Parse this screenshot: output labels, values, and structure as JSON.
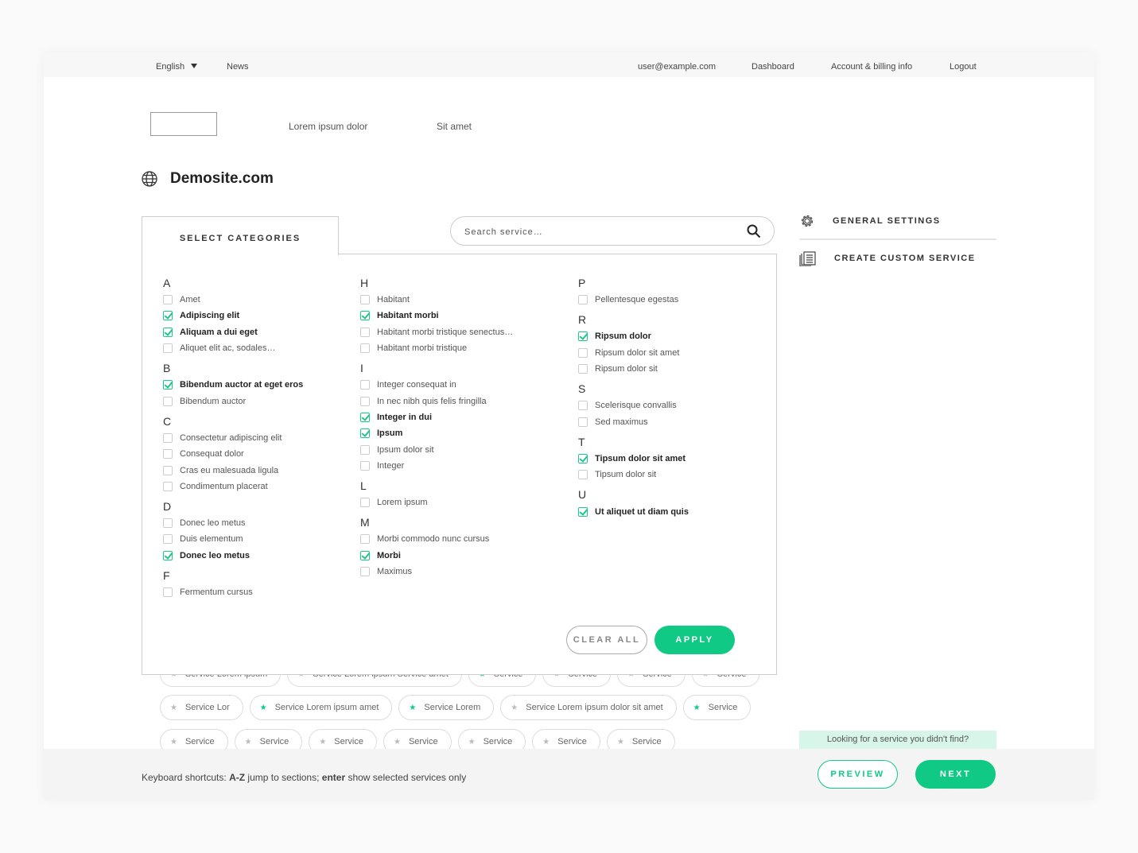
{
  "topbar": {
    "language": "English",
    "news": "News",
    "email": "user@example.com",
    "dashboard": "Dashboard",
    "account": "Account & billing info",
    "logout": "Logout"
  },
  "nav": {
    "item1": "Lorem ipsum dolor",
    "item2": "Sit amet"
  },
  "site": {
    "title": "Demosite.com"
  },
  "categories_tab": "SELECT CATEGORIES",
  "search": {
    "placeholder": "Search service…"
  },
  "columns": [
    [
      {
        "letter": "A",
        "items": [
          [
            "Amet",
            false
          ],
          [
            "Adipiscing elit",
            true
          ],
          [
            "Aliquam a dui eget",
            true
          ],
          [
            "Aliquet elit ac, sodales…",
            false
          ]
        ]
      },
      {
        "letter": "B",
        "items": [
          [
            "Bibendum auctor at eget eros",
            true
          ],
          [
            "Bibendum auctor",
            false
          ]
        ]
      },
      {
        "letter": "C",
        "items": [
          [
            "Consectetur adipiscing elit",
            false
          ],
          [
            "Consequat dolor",
            false
          ],
          [
            "Cras eu malesuada ligula",
            false
          ],
          [
            "Condimentum placerat",
            false
          ]
        ]
      },
      {
        "letter": "D",
        "items": [
          [
            "Donec leo metus",
            false
          ],
          [
            "Duis elementum",
            false
          ],
          [
            "Donec leo metus",
            true
          ]
        ]
      },
      {
        "letter": "F",
        "items": [
          [
            "Fermentum cursus",
            false
          ]
        ]
      }
    ],
    [
      {
        "letter": "H",
        "items": [
          [
            "Habitant",
            false
          ],
          [
            "Habitant morbi",
            true
          ],
          [
            "Habitant morbi tristique senectus…",
            false
          ],
          [
            "Habitant morbi tristique",
            false
          ]
        ]
      },
      {
        "letter": "I",
        "items": [
          [
            "Integer consequat in",
            false
          ],
          [
            "In nec nibh quis felis fringilla",
            false
          ],
          [
            "Integer in dui",
            true
          ],
          [
            "Ipsum",
            true
          ],
          [
            "Ipsum dolor sit",
            false
          ],
          [
            "Integer",
            false
          ]
        ]
      },
      {
        "letter": "L",
        "items": [
          [
            "Lorem ipsum",
            false
          ]
        ]
      },
      {
        "letter": "M",
        "items": [
          [
            "Morbi commodo nunc cursus",
            false
          ],
          [
            "Morbi",
            true
          ],
          [
            "Maximus",
            false
          ]
        ]
      }
    ],
    [
      {
        "letter": "P",
        "items": [
          [
            "Pellentesque egestas",
            false
          ]
        ]
      },
      {
        "letter": "R",
        "items": [
          [
            "Ripsum dolor",
            true
          ],
          [
            "Ripsum dolor sit amet",
            false
          ],
          [
            "Ripsum dolor sit",
            false
          ]
        ]
      },
      {
        "letter": "S",
        "items": [
          [
            "Scelerisque convallis",
            false
          ],
          [
            "Sed maximus",
            false
          ]
        ]
      },
      {
        "letter": "T",
        "items": [
          [
            "Tipsum dolor sit amet",
            true
          ],
          [
            "Tipsum dolor sit",
            false
          ]
        ]
      },
      {
        "letter": "U",
        "items": [
          [
            "Ut aliquet ut diam quis",
            true
          ]
        ]
      }
    ]
  ],
  "buttons": {
    "clear": "CLEAR ALL",
    "apply": "APPLY",
    "preview": "PREVIEW",
    "next": "NEXT"
  },
  "side": {
    "general": "GENERAL SETTINGS",
    "custom": "CREATE CUSTOM SERVICE"
  },
  "chips": [
    [
      [
        "Service Lorem ipsum",
        false
      ],
      [
        "Service Lorem ipsum Service amet",
        false
      ],
      [
        "Service",
        true
      ],
      [
        "Service",
        false
      ],
      [
        "Service",
        false
      ],
      [
        "Service",
        false
      ]
    ],
    [
      [
        "Service Lor",
        false
      ],
      [
        "Service Lorem ipsum amet",
        true
      ],
      [
        "Service Lorem",
        true
      ],
      [
        "Service Lorem ipsum dolor sit amet",
        false
      ],
      [
        "Service",
        true
      ]
    ],
    [
      [
        "Service",
        false
      ],
      [
        "Service",
        false
      ],
      [
        "Service",
        false
      ],
      [
        "Service",
        false
      ],
      [
        "Service",
        false
      ],
      [
        "Service",
        false
      ],
      [
        "Service",
        false
      ]
    ]
  ],
  "looking": "Looking for a service you didn't find?",
  "shortcuts": {
    "prefix": "Keyboard shortcuts: ",
    "az": "A-Z",
    "mid": " jump to sections; ",
    "enter": "enter",
    "suffix": " show selected services only"
  },
  "colors": {
    "accent": "#10c985"
  }
}
